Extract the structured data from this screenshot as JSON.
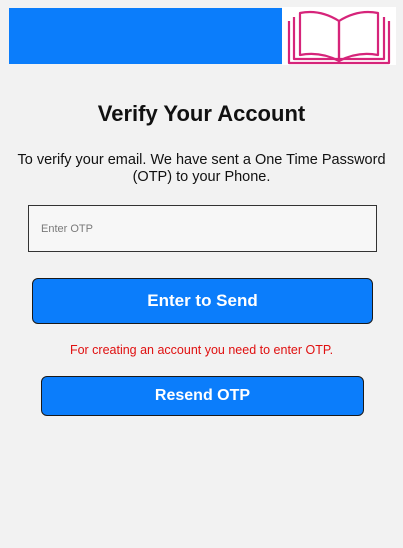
{
  "header": {
    "logo_icon": "open-book-icon",
    "accent_color": "#0b7dfb",
    "logo_color": "#d6247a"
  },
  "verify": {
    "title": "Verify Your Account",
    "description": "To verify your email. We have sent a One Time Password (OTP) to your Phone.",
    "otp_placeholder": "Enter OTP",
    "otp_value": "",
    "send_label": "Enter to Send",
    "error_message": "For creating an account you need to enter OTP.",
    "resend_label": "Resend OTP",
    "error_color": "#e01010"
  }
}
